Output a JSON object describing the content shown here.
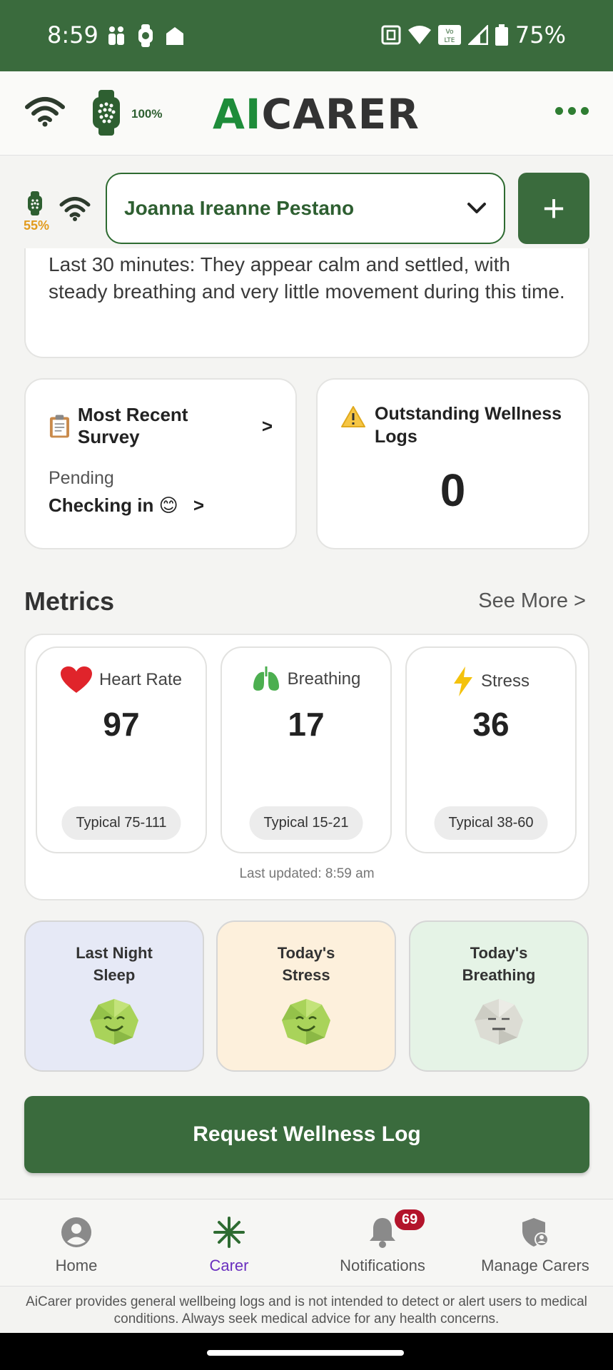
{
  "status_bar": {
    "time": "8:59",
    "battery": "75%"
  },
  "header": {
    "watch_battery": "100%",
    "logo_ai": "AI",
    "logo_carer": "CARER"
  },
  "patient": {
    "watch_battery": "55%",
    "name": "Joanna Ireanne Pestano",
    "add_label": "+"
  },
  "summary": {
    "text": "Last 30 minutes: They appear calm and settled, with steady breathing and very little movement during this time."
  },
  "survey": {
    "title": "Most Recent Survey",
    "title_arrow": ">",
    "status": "Pending",
    "link": "Checking in 😊",
    "link_arrow": ">"
  },
  "wellness_logs": {
    "title": "Outstanding Wellness Logs",
    "count": "0"
  },
  "metrics": {
    "title": "Metrics",
    "see_more": "See More  >",
    "items": [
      {
        "label": "Heart Rate",
        "value": "97",
        "typical": "Typical 75-111",
        "icon": "heart-icon",
        "color": "#e0242b"
      },
      {
        "label": "Breathing",
        "value": "17",
        "typical": "Typical 15-21",
        "icon": "lungs-icon",
        "color": "#4caf50"
      },
      {
        "label": "Stress",
        "value": "36",
        "typical": "Typical 38-60",
        "icon": "lightning-icon",
        "color": "#f4c20d"
      }
    ],
    "last_updated": "Last updated: 8:59 am"
  },
  "moods": [
    {
      "title": "Last Night Sleep",
      "bg": "#e6e9f6",
      "face": "happy"
    },
    {
      "title": "Today's Stress",
      "bg": "#fdf0dc",
      "face": "happy"
    },
    {
      "title": "Today's Breathing",
      "bg": "#e5f3e6",
      "face": "neutral"
    }
  ],
  "request_button": "Request Wellness Log",
  "nav": {
    "home": "Home",
    "carer": "Carer",
    "notifications": "Notifications",
    "notifications_badge": "69",
    "manage_carers": "Manage Carers"
  },
  "disclaimer": "AiCarer provides general wellbeing logs and is not intended to detect or alert users to medical conditions. Always seek medical advice for any health concerns.",
  "colors": {
    "brand_green": "#3a6b3d",
    "accent_purple": "#6a2fbf"
  }
}
